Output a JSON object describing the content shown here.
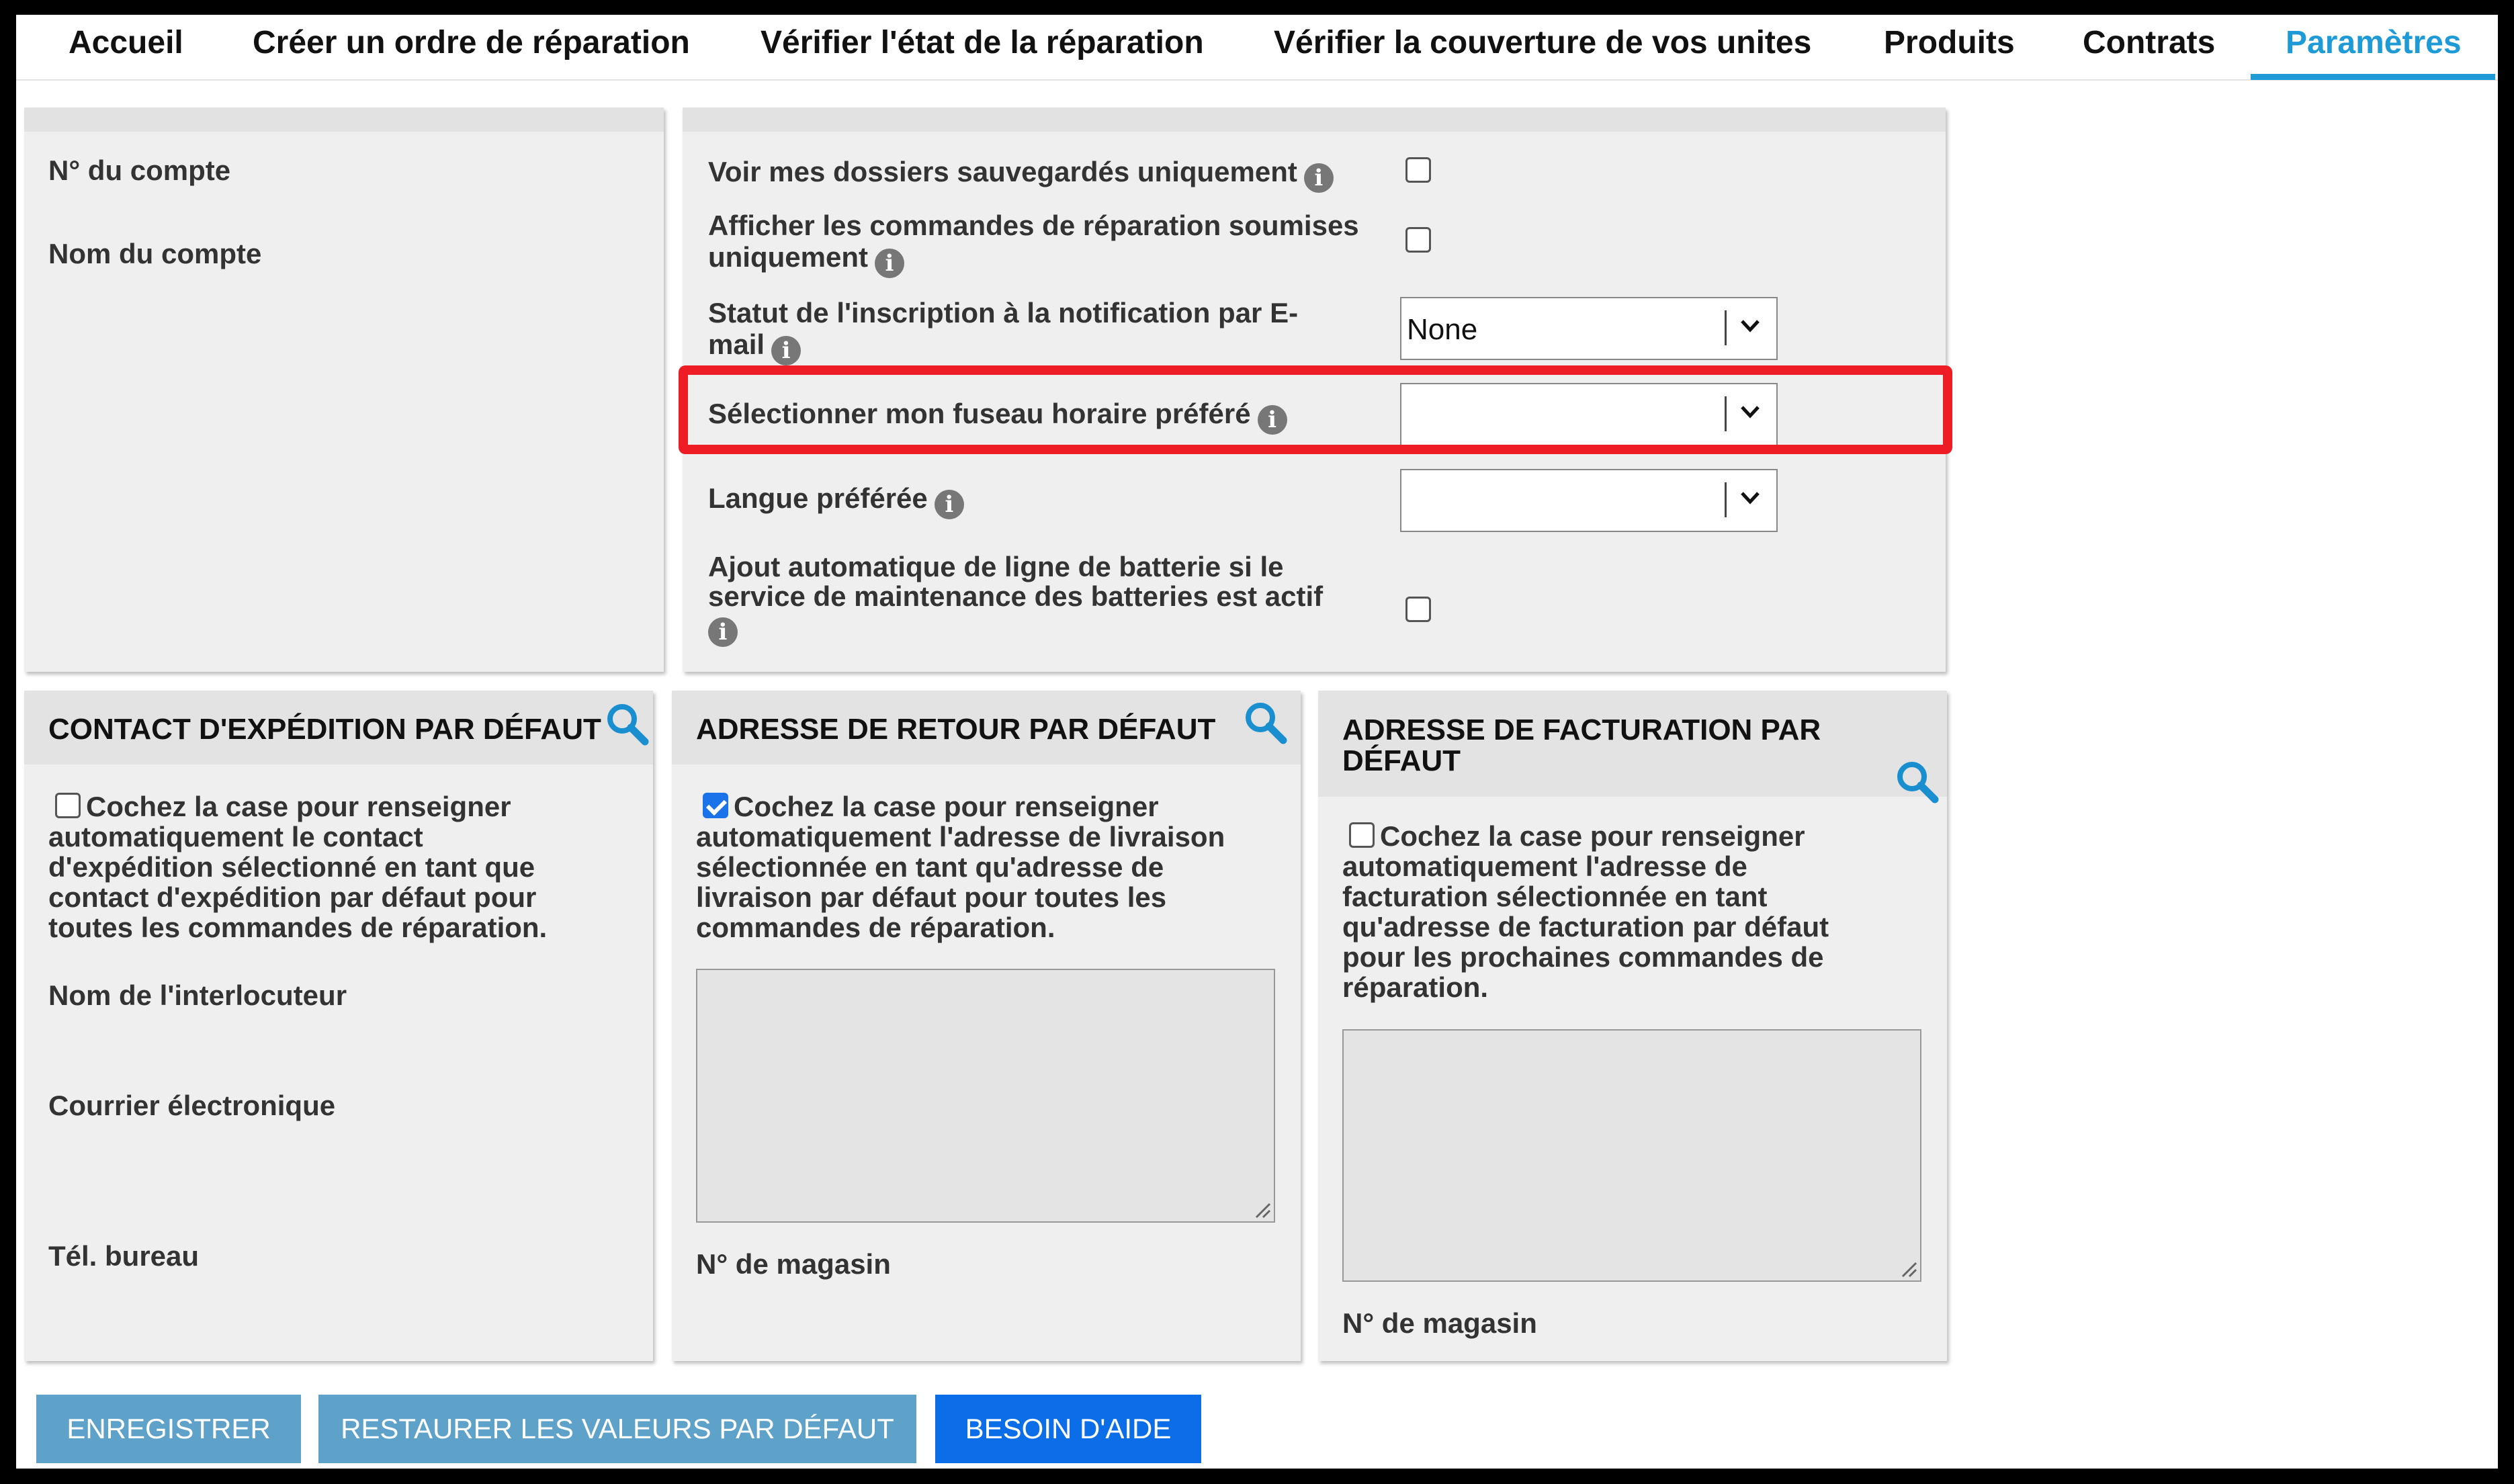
{
  "nav": {
    "tabs": [
      {
        "label": "Accueil"
      },
      {
        "label": "Créer un ordre de réparation"
      },
      {
        "label": "Vérifier l'état de la réparation"
      },
      {
        "label": "Vérifier la couverture de vos unites"
      },
      {
        "label": "Produits"
      },
      {
        "label": "Contrats"
      },
      {
        "label": "Paramètres",
        "active": true
      }
    ]
  },
  "account": {
    "number_label": "N° du compte",
    "name_label": "Nom du compte"
  },
  "settings": {
    "saved_files_only": {
      "label": "Voir mes dossiers sauvegardés uniquement",
      "checked": false
    },
    "submitted_orders_only": {
      "label_line1": "Afficher les commandes de réparation soumises",
      "label_line2": "uniquement",
      "checked": false
    },
    "email_notification": {
      "label_line1": "Statut de l'inscription à la notification par E-",
      "label_line2": "mail",
      "value": "None"
    },
    "timezone": {
      "label": "Sélectionner mon fuseau horaire préféré",
      "value": ""
    },
    "language": {
      "label": "Langue préférée",
      "value": ""
    },
    "battery_line": {
      "label_line1": "Ajout automatique de ligne de batterie si le",
      "label_line2": "service de maintenance des batteries est actif",
      "checked": false
    }
  },
  "shipping_contact": {
    "title": "CONTACT D'EXPÉDITION PAR DÉFAUT",
    "autofill": {
      "checked": false,
      "lines": [
        "Cochez la case pour renseigner",
        "automatiquement le contact",
        "d'expédition sélectionné en tant que",
        "contact d'expédition par défaut pour",
        "toutes les commandes de réparation."
      ]
    },
    "contact_name_label": "Nom de l'interlocuteur",
    "email_label": "Courrier électronique",
    "phone_label": "Tél. bureau"
  },
  "return_address": {
    "title": "ADRESSE DE RETOUR PAR DÉFAUT",
    "autofill": {
      "checked": true,
      "lines": [
        "Cochez la case pour renseigner",
        "automatiquement l'adresse de livraison",
        "sélectionnée en tant qu'adresse de",
        "livraison par défaut pour toutes les",
        "commandes de réparation."
      ]
    },
    "store_label": "N° de magasin"
  },
  "billing_address": {
    "title_line1": "ADRESSE DE FACTURATION PAR",
    "title_line2": "DÉFAUT",
    "autofill": {
      "checked": false,
      "lines": [
        "Cochez la case pour renseigner",
        "automatiquement l'adresse de",
        "facturation sélectionnée en tant",
        "qu'adresse de facturation par défaut",
        "pour les prochaines commandes de",
        "réparation."
      ]
    },
    "store_label": "N° de magasin"
  },
  "buttons": {
    "save": "ENREGISTRER",
    "restore": "RESTAURER LES VALEURS PAR DÉFAUT",
    "help": "BESOIN D'AIDE"
  },
  "colors": {
    "accent": "#1e9ad6",
    "highlight": "#ee1c24",
    "help_button": "#0b6ee8",
    "secondary_button": "#5ea2c9"
  },
  "icons": {
    "info": "info-icon",
    "search": "search-icon",
    "dropdown": "chevron-down-icon"
  }
}
